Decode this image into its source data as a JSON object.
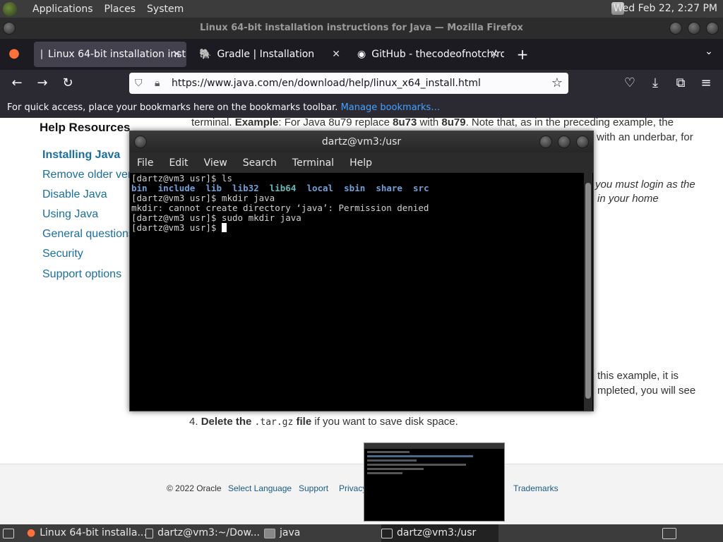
{
  "top_panel": {
    "menus": [
      "Applications",
      "Places",
      "System"
    ],
    "clock": "Wed Feb 22,  2:27 PM"
  },
  "firefox": {
    "window_title": "Linux 64-bit installation instructions for Java — Mozilla Firefox",
    "tabs": [
      {
        "label": "Linux 64-bit installation inst",
        "active": true
      },
      {
        "label": "Gradle | Installation",
        "active": false
      },
      {
        "label": "GitHub - thecodeofnotch/rd",
        "active": false
      }
    ],
    "url": "https://www.java.com/en/download/help/linux_x64_install.html",
    "bookmarks_text": "For quick access, place your bookmarks here on the bookmarks toolbar.",
    "bookmarks_link": "Manage bookmarks…"
  },
  "page": {
    "help_heading": "Help Resources",
    "side_links": [
      "Installing Java",
      "Remove older vers",
      "Disable Java",
      "Using Java",
      "General questions",
      "Security",
      "Support options"
    ],
    "article_lines": {
      "l1a": "terminal. ",
      "l1b": "Example",
      "l1c": ": For Java 8u79 replace ",
      "l1d": "8u73",
      "l1e": " with ",
      "l1f": "8u79",
      "l1g": ". Note that, as in the preceding example, the",
      "l2": "with an underbar, for",
      "l3": "you must login as the",
      "l4": "in your home",
      "l5": "this example, it is",
      "l6": "mpleted, you will see",
      "step4_num": "4. ",
      "step4_bold": "Delete the ",
      "step4_code": ".tar.gz",
      "step4_bold2": " file",
      "step4_rest": " if you want to save disk space."
    },
    "footer_links": [
      "© 2022 Oracle",
      "Select Language",
      "Support",
      "Privacy",
      "Trademarks"
    ]
  },
  "terminal": {
    "title": "dartz@vm3:/usr",
    "menu": [
      "File",
      "Edit",
      "View",
      "Search",
      "Terminal",
      "Help"
    ],
    "lines": {
      "l1": "[dartz@vm3 usr]$ ls",
      "dirs": [
        "bin",
        "include",
        "lib",
        "lib32",
        "lib64",
        "local",
        "sbin",
        "share",
        "src"
      ],
      "l3": "[dartz@vm3 usr]$ mkdir java",
      "l4": "mkdir: cannot create directory ‘java’: Permission denied",
      "l5": "[dartz@vm3 usr]$ sudo mkdir java",
      "l6": "[dartz@vm3 usr]$ "
    }
  },
  "taskbar": {
    "items": [
      "Linux 64-bit installa...",
      "dartz@vm3:~/Dow...",
      "java",
      "dartz@vm3:/usr"
    ]
  }
}
